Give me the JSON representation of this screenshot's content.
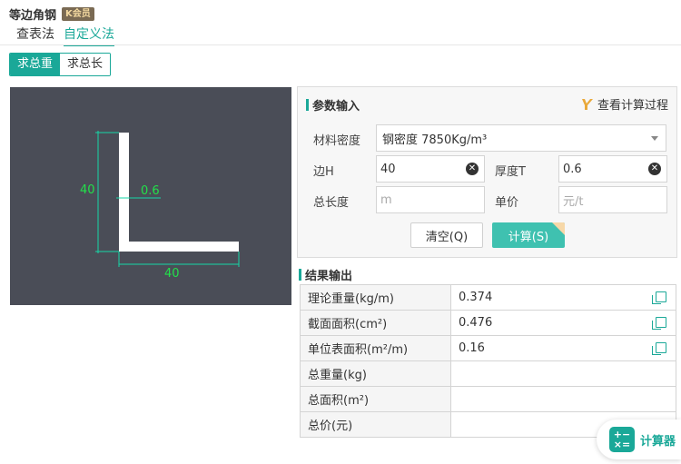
{
  "header": {
    "title": "等边角钢",
    "vip_badge": "K会员"
  },
  "tabs": [
    {
      "label": "查表法"
    },
    {
      "label": "自定义法",
      "active": true
    }
  ],
  "mode": [
    {
      "label": "求总重",
      "active": true
    },
    {
      "label": "求总长"
    }
  ],
  "diagram": {
    "height_label": "40",
    "thickness_label": "0.6",
    "width_label": "40"
  },
  "params": {
    "title": "参数输入",
    "view_process": "查看计算过程",
    "density_label": "材料密度",
    "density_value": "钢密度 7850Kg/m³",
    "edge_label": "边H",
    "edge_value": "40",
    "thickness_label": "厚度T",
    "thickness_value": "0.6",
    "length_label": "总长度",
    "length_placeholder": "m",
    "price_label": "单价",
    "price_placeholder": "元/t",
    "clear_btn": "清空(Q)",
    "calc_btn": "计算(S)"
  },
  "results": {
    "title": "结果输出",
    "rows": [
      {
        "label": "理论重量(kg/m)",
        "value": "0.374",
        "copy": true
      },
      {
        "label": "截面面积(cm²)",
        "value": "0.476",
        "copy": true
      },
      {
        "label": "单位表面积(m²/m)",
        "value": "0.16",
        "copy": true
      },
      {
        "label": "总重量(kg)",
        "value": ""
      },
      {
        "label": "总面积(m²)",
        "value": ""
      },
      {
        "label": "总价(元)",
        "value": ""
      }
    ]
  },
  "floating": {
    "label": "计算器"
  },
  "colors": {
    "accent": "#1aa898",
    "canvas": "#4a4d57",
    "dimension": "#16d7a7",
    "dimension_text": "#22e04a"
  }
}
